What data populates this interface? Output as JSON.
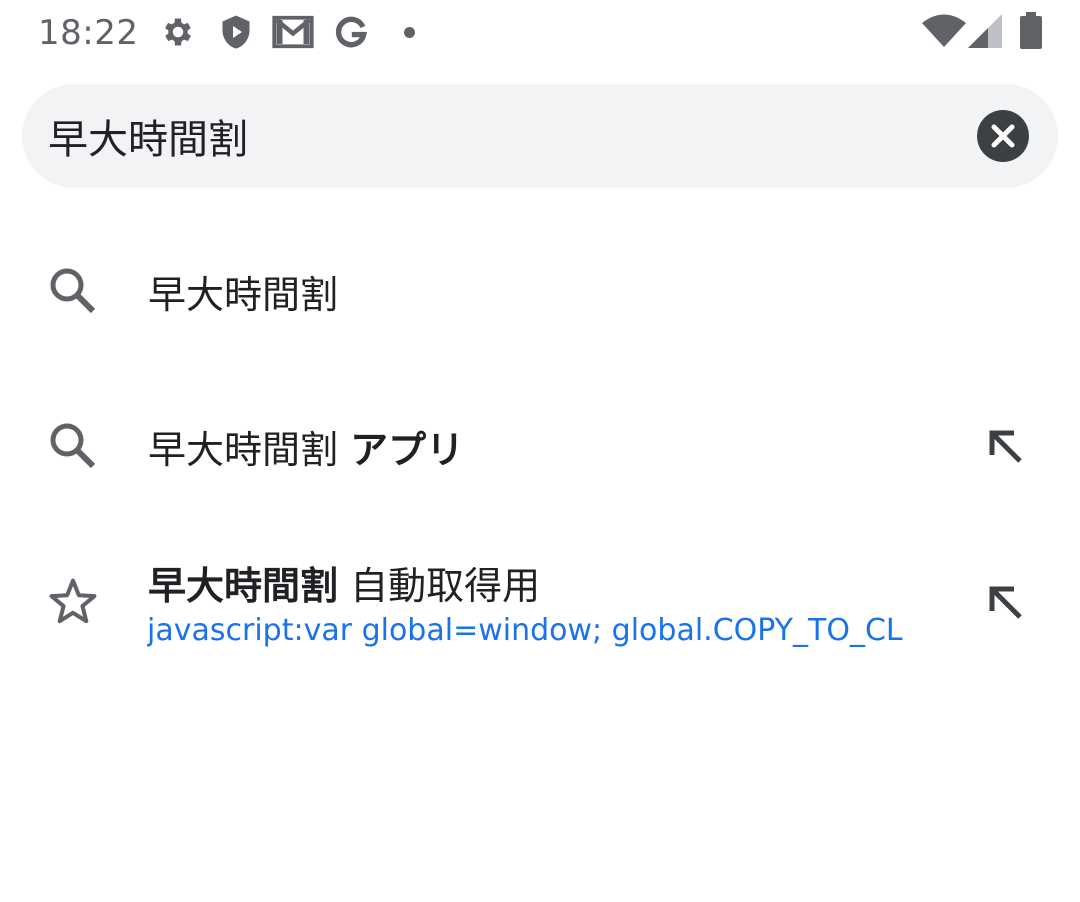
{
  "status_bar": {
    "time": "18:22",
    "left_icons": [
      "gear-icon",
      "shield-play-icon",
      "gmail-icon",
      "google-g-icon",
      "notification-dot-icon"
    ],
    "right_icons": [
      "wifi-icon",
      "cell-signal-icon",
      "battery-icon"
    ]
  },
  "search": {
    "query": "早大時間割",
    "clear_icon": "close-circle-icon"
  },
  "suggestions": [
    {
      "icon": "search-icon",
      "text": "早大時間割"
    },
    {
      "icon": "search-icon",
      "text_plain": "早大時間割",
      "text_bold": "アプリ",
      "action_icon": "north-west-arrow-icon"
    },
    {
      "icon": "star-icon",
      "title_bold": "早大時間割",
      "title_plain": "自動取得用",
      "url": "javascript:var global=window; global.COPY_TO_CL",
      "action_icon": "north-west-arrow-icon"
    }
  ],
  "colors": {
    "accent": "#1a73e8",
    "text": "#202124",
    "icon": "#5f6368",
    "search_bg": "#f1f3f4"
  }
}
